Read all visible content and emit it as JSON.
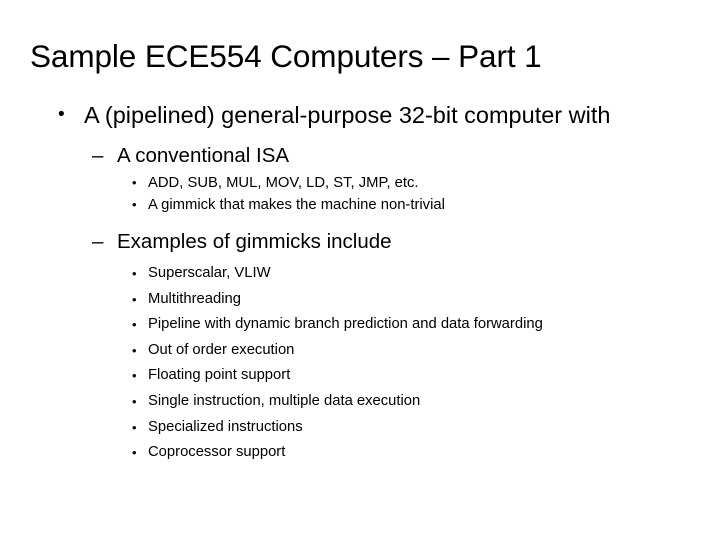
{
  "slide": {
    "title": "Sample ECE554 Computers – Part 1",
    "bullet_marks": {
      "level1": "•",
      "level2": "–",
      "level3": "•"
    },
    "content": {
      "level1": [
        {
          "text": "A (pipelined) general-purpose 32-bit computer with"
        }
      ],
      "level2": [
        {
          "text": "A conventional ISA"
        },
        {
          "text": "Examples of gimmicks include"
        }
      ],
      "level3_group_isa": [
        "ADD, SUB, MUL, MOV, LD, ST, JMP, etc.",
        "A gimmick that makes the machine non-trivial"
      ],
      "level3_group_gimmicks": [
        "Superscalar, VLIW",
        "Multithreading",
        "Pipeline with dynamic branch prediction and data forwarding",
        "Out of order execution",
        "Floating point support",
        "Single instruction, multiple data execution",
        "Specialized instructions",
        "Coprocessor support"
      ]
    }
  },
  "colors": {
    "background": "#ffffff",
    "text": "#000000"
  }
}
